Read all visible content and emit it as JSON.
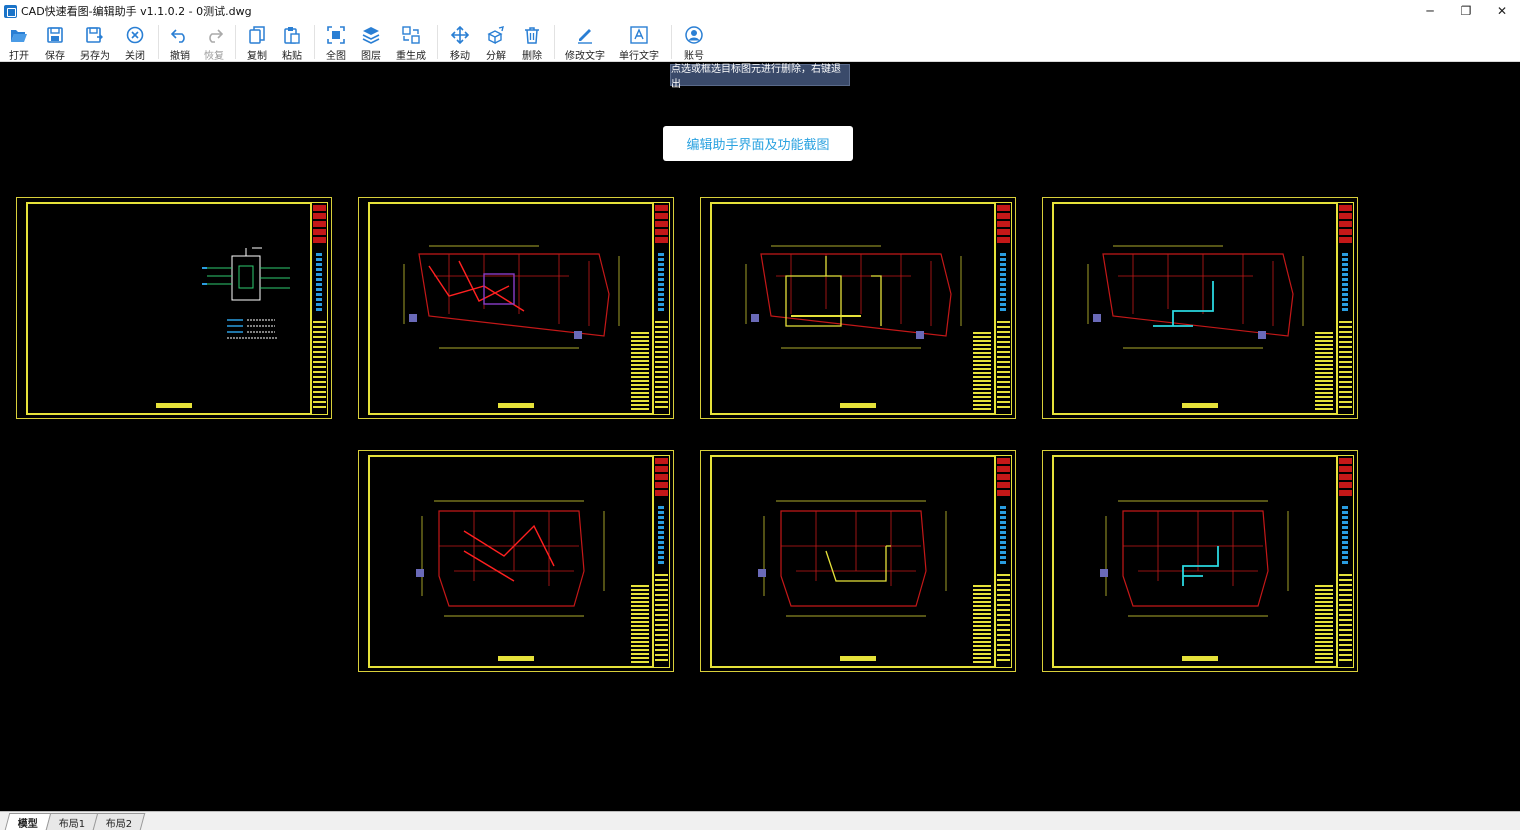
{
  "window": {
    "title": "CAD快速看图-编辑助手 v1.1.0.2 - 0测试.dwg",
    "minimize": "─",
    "restore": "❐",
    "close": "✕"
  },
  "toolbar": {
    "open": "打开",
    "save": "保存",
    "save_as": "另存为",
    "close": "关闭",
    "undo": "撤销",
    "redo": "恢复",
    "copy": "复制",
    "paste": "粘贴",
    "fit_all": "全图",
    "layers": "图层",
    "regen": "重生成",
    "move": "移动",
    "explode": "分解",
    "delete": "删除",
    "edit_text": "修改文字",
    "single_text": "单行文字",
    "account": "账号"
  },
  "tooltip": "点选或框选目标图元进行删除，右键退出",
  "banner": "编辑助手界面及功能截图",
  "tabs": [
    {
      "label": "模型",
      "active": true
    },
    {
      "label": "布局1",
      "active": false
    },
    {
      "label": "布局2",
      "active": false
    }
  ],
  "colors": {
    "accent": "#2aa2e0",
    "frame_yellow": "#e6e23a",
    "plan_red": "#c41818",
    "canvas": "#000000"
  }
}
